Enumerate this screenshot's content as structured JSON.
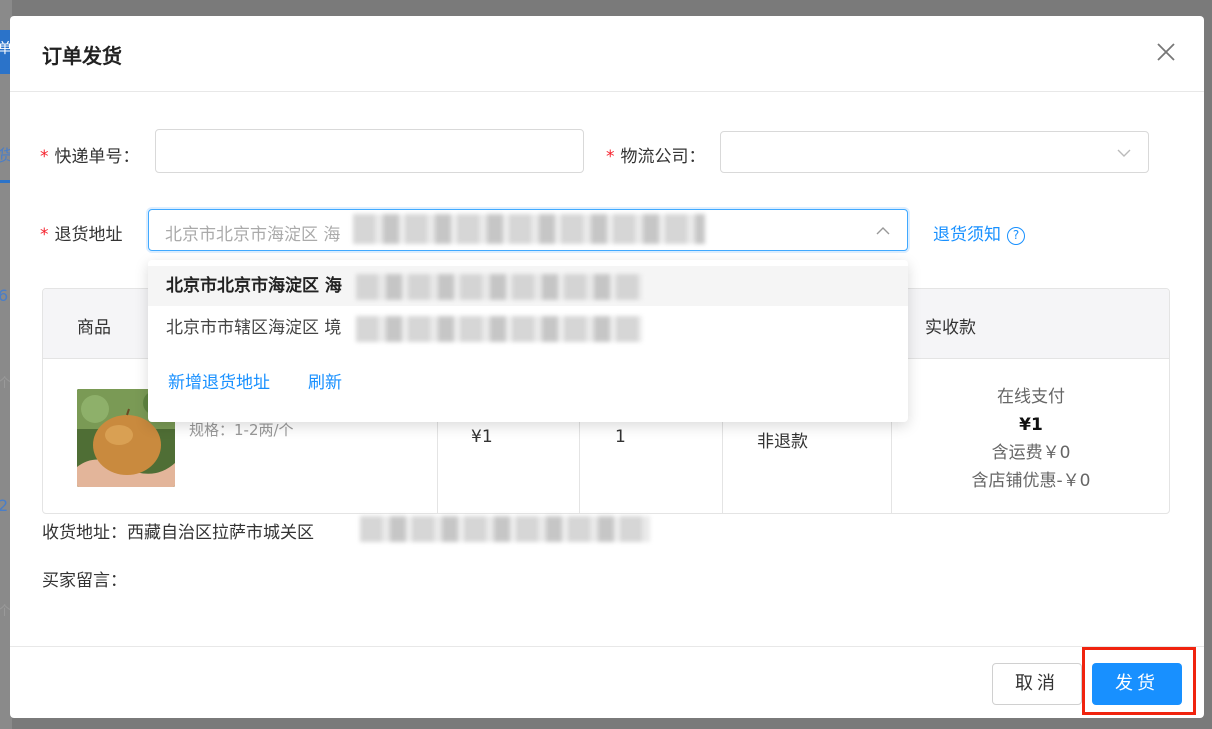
{
  "background": {
    "fragments": [
      "单",
      "货",
      "6",
      "个",
      "2",
      "个"
    ]
  },
  "dialog": {
    "title": "订单发货"
  },
  "form": {
    "required_mark": "*",
    "tracking_label": "快递单号：",
    "tracking_value": "",
    "carrier_label": "物流公司：",
    "carrier_value": "",
    "return_label": "退货地址",
    "return_value_visible": "北京市北京市海淀区 海",
    "return_notice_link": "退货须知",
    "help_glyph": "?"
  },
  "dropdown": {
    "options": [
      {
        "label": "北京市北京市海淀区 海",
        "selected": true
      },
      {
        "label": "北京市市辖区海淀区 境",
        "selected": false
      }
    ],
    "add_link": "新增退货地址",
    "refresh_link": "刷新"
  },
  "table": {
    "headers": {
      "product": "商品",
      "received": "实收款"
    },
    "row": {
      "spec": "规格：1-2两/个",
      "price": "¥1",
      "quantity": "1",
      "refund_status": "非退款",
      "payment_method": "在线支付",
      "amount": "¥1",
      "shipping_fee": "含运费￥0",
      "shop_discount": "含店铺优惠-￥0"
    }
  },
  "info": {
    "shipping_address_label": "收货地址：",
    "shipping_address_visible": "西藏自治区拉萨市城关区",
    "buyer_note_label": "买家留言："
  },
  "footer": {
    "cancel_label": "取消",
    "ship_label": "发货"
  },
  "colors": {
    "primary": "#1890ff",
    "required": "#f5222d",
    "highlight_frame": "#f0230e"
  }
}
